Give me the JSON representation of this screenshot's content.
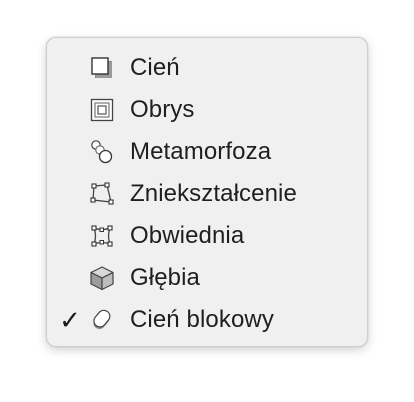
{
  "menu": {
    "items": [
      {
        "label": "Cień",
        "icon": "shadow-icon",
        "checked": false
      },
      {
        "label": "Obrys",
        "icon": "outline-icon",
        "checked": false
      },
      {
        "label": "Metamorfoza",
        "icon": "morph-icon",
        "checked": false
      },
      {
        "label": "Zniekształcenie",
        "icon": "distort-icon",
        "checked": false
      },
      {
        "label": "Obwiednia",
        "icon": "envelope-icon",
        "checked": false
      },
      {
        "label": "Głębia",
        "icon": "depth-cube-icon",
        "checked": false
      },
      {
        "label": "Cień blokowy",
        "icon": "block-shadow-icon",
        "checked": true,
        "check_mark": "✓"
      }
    ]
  }
}
